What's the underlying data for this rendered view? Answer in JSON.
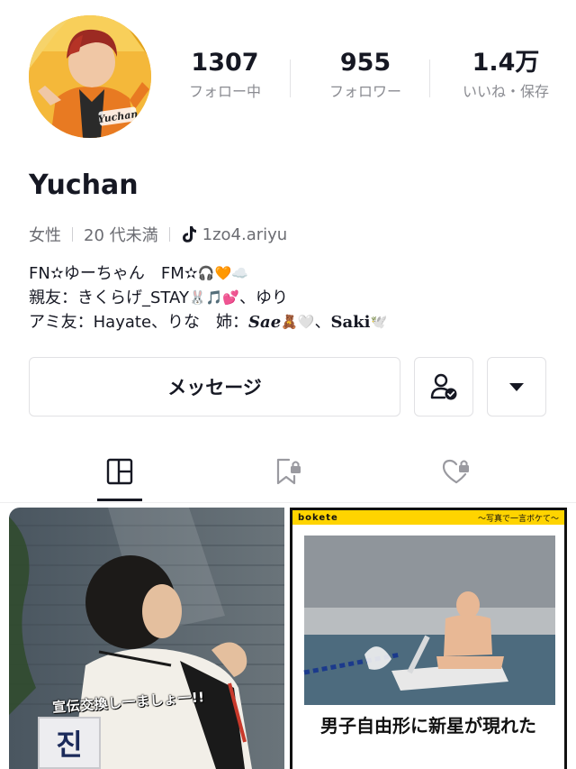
{
  "profile": {
    "stats": [
      {
        "value": "1307",
        "label": "フォロー中"
      },
      {
        "value": "955",
        "label": "フォロワー"
      },
      {
        "value": "1.4万",
        "label": "いいね・保存"
      }
    ],
    "name": "Yuchan",
    "avatar_text": "Yuchan",
    "gender": "女性",
    "age": "20 代未満",
    "tiktok_id": "1zo4.ariyu",
    "bio": {
      "line1": "FN✫ゆーちゃん　FM✫",
      "line1_emoji": "🎧🧡☁️",
      "line2": "親友：きくらげ_STAY",
      "line2_emoji": "🐰🎵💕",
      "line2_tail": "、ゆり",
      "line3": "アミ友：Hayate、りな　姉：",
      "line3_sae": "Sae",
      "line3_emoji1": "🧸🤍",
      "line3_mid": "、",
      "line3_saki": "Saki",
      "line3_emoji2": "🕊️"
    }
  },
  "actions": {
    "message_label": "メッセージ"
  },
  "posts": [
    {
      "caption": "宣伝交換し一ましょ一!!",
      "patch_text": "진"
    },
    {
      "brand": "bokete",
      "tagline": "〜写真で一言ボケて〜",
      "title": "男子自由形に新星が現れた"
    }
  ],
  "colors": {
    "text_primary": "#161823",
    "text_secondary": "#8a8b91",
    "border": "#e1e1e4",
    "bokete_yellow": "#ffd400",
    "avatar_orange": "#e8822a"
  }
}
